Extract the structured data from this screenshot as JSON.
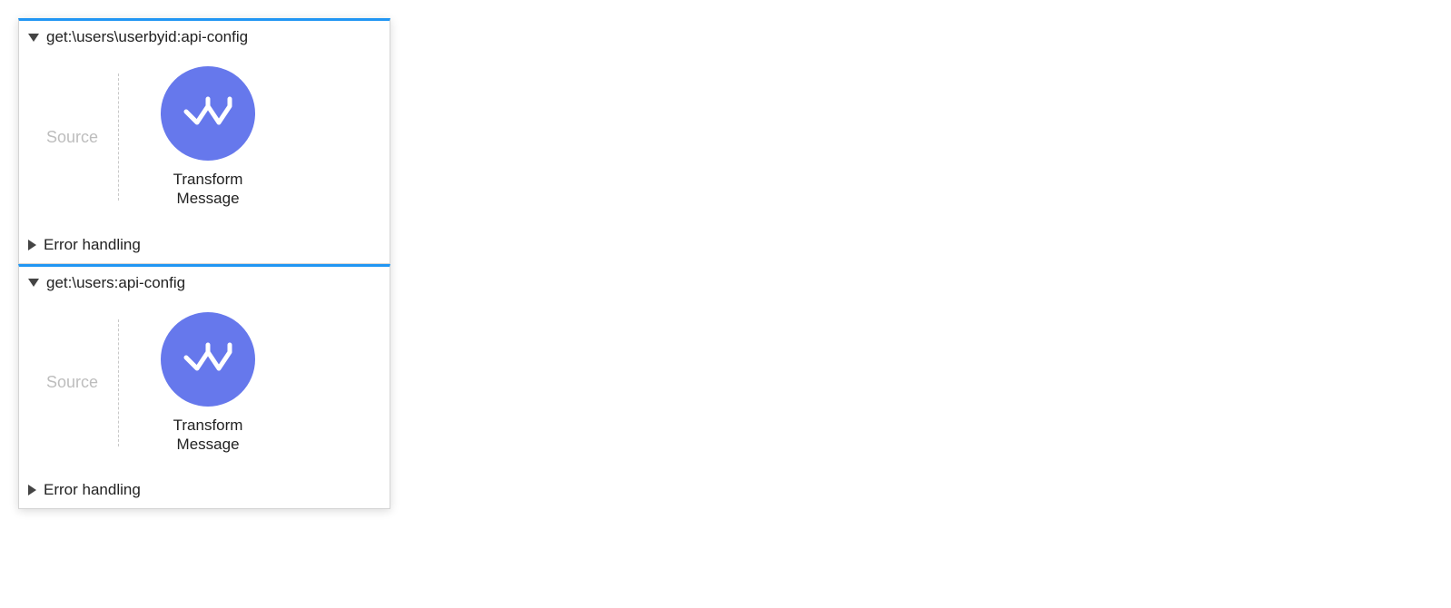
{
  "flows": [
    {
      "title": "get:\\users\\userbyid:api-config",
      "source_label": "Source",
      "component_label": "Transform\nMessage",
      "error_label": "Error handling"
    },
    {
      "title": "get:\\users:api-config",
      "source_label": "Source",
      "component_label": "Transform\nMessage",
      "error_label": "Error handling"
    }
  ],
  "colors": {
    "accent": "#2196f3",
    "icon_bg": "#6678ec"
  }
}
